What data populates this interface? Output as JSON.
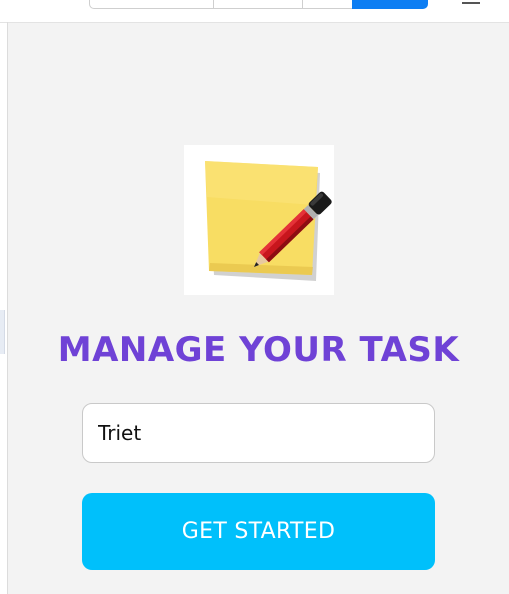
{
  "app": {
    "heading": "MANAGE YOUR TASK",
    "logo_icon": "sticky-note-pencil-icon"
  },
  "form": {
    "name_value": "Triet",
    "start_label": "GET STARTED"
  },
  "colors": {
    "heading": "#6f42d6",
    "button": "#00c0fb",
    "background": "#f3f3f3",
    "toolbar_active": "#0d7ef3"
  },
  "toolbar": {
    "icons": [
      "menu-icon"
    ]
  }
}
